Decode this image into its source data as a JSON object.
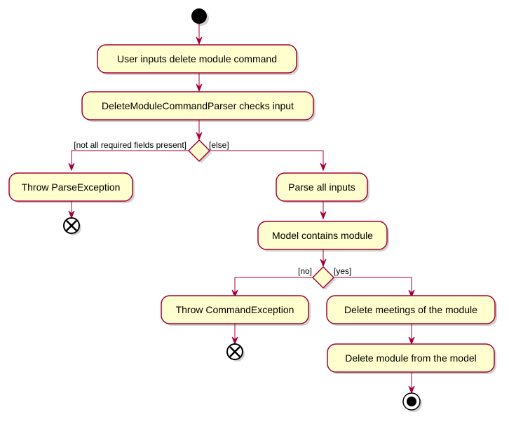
{
  "diagram": {
    "type": "activity",
    "colors": {
      "activity_fill": "#FEFECE",
      "border": "#A80036",
      "start_node": "#000000"
    },
    "activities": {
      "user_input": "User inputs delete module command",
      "parser_check": "DeleteModuleCommandParser checks input",
      "throw_parse": "Throw ParseException",
      "parse_inputs": "Parse all inputs",
      "model_contains": "Model contains module",
      "throw_command": "Throw CommandException",
      "delete_meetings": "Delete meetings of the module",
      "delete_module": "Delete module from the model"
    },
    "guards": {
      "not_all_fields": "[not all required fields present]",
      "else": "[else]",
      "no": "[no]",
      "yes": "[yes]"
    },
    "nodes": [
      {
        "id": "start",
        "kind": "start"
      },
      {
        "id": "user_input",
        "kind": "activity"
      },
      {
        "id": "parser_check",
        "kind": "activity"
      },
      {
        "id": "decision1",
        "kind": "decision"
      },
      {
        "id": "throw_parse",
        "kind": "activity"
      },
      {
        "id": "end_flow1",
        "kind": "flow-final"
      },
      {
        "id": "parse_inputs",
        "kind": "activity"
      },
      {
        "id": "model_contains",
        "kind": "activity"
      },
      {
        "id": "decision2",
        "kind": "decision"
      },
      {
        "id": "throw_command",
        "kind": "activity"
      },
      {
        "id": "end_flow2",
        "kind": "flow-final"
      },
      {
        "id": "delete_meetings",
        "kind": "activity"
      },
      {
        "id": "delete_module",
        "kind": "activity"
      },
      {
        "id": "stop",
        "kind": "stop"
      }
    ],
    "edges": [
      {
        "from": "start",
        "to": "user_input"
      },
      {
        "from": "user_input",
        "to": "parser_check"
      },
      {
        "from": "parser_check",
        "to": "decision1"
      },
      {
        "from": "decision1",
        "to": "throw_parse",
        "guard": "[not all required fields present]"
      },
      {
        "from": "decision1",
        "to": "parse_inputs",
        "guard": "[else]"
      },
      {
        "from": "throw_parse",
        "to": "end_flow1"
      },
      {
        "from": "parse_inputs",
        "to": "model_contains"
      },
      {
        "from": "model_contains",
        "to": "decision2"
      },
      {
        "from": "decision2",
        "to": "throw_command",
        "guard": "[no]"
      },
      {
        "from": "decision2",
        "to": "delete_meetings",
        "guard": "[yes]"
      },
      {
        "from": "throw_command",
        "to": "end_flow2"
      },
      {
        "from": "delete_meetings",
        "to": "delete_module"
      },
      {
        "from": "delete_module",
        "to": "stop"
      }
    ]
  }
}
